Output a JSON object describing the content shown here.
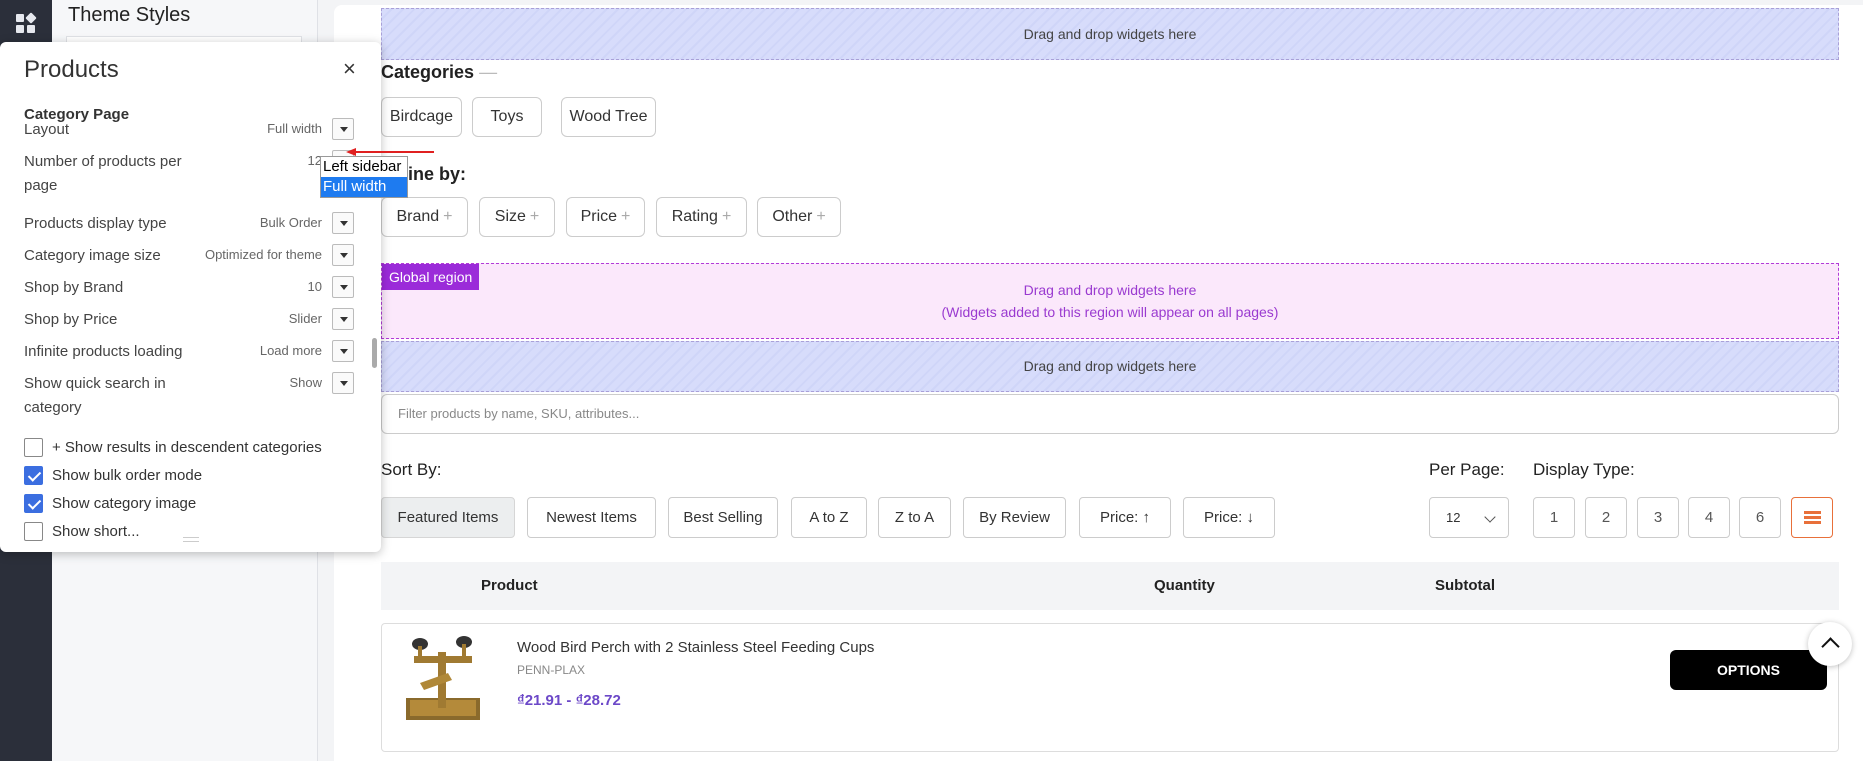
{
  "editor": {
    "title": "Theme Styles"
  },
  "popover": {
    "title": "Products",
    "close_label": "×",
    "section": "Category Page",
    "settings": [
      {
        "label": "Layout",
        "value": "Full width"
      },
      {
        "label": "Number of products per page",
        "value": "12"
      },
      {
        "label": "Products display type",
        "value": "Bulk Order"
      },
      {
        "label": "Category image size",
        "value": "Optimized for theme"
      },
      {
        "label": "Shop by Brand",
        "value": "10"
      },
      {
        "label": "Shop by Price",
        "value": "Slider"
      },
      {
        "label": "Infinite products loading",
        "value": "Load more"
      },
      {
        "label": "Show quick search in category",
        "value": "Show"
      }
    ],
    "checks": [
      {
        "label": "+ Show results in descendent categories",
        "checked": false
      },
      {
        "label": "Show bulk order mode",
        "checked": true
      },
      {
        "label": "Show category image",
        "checked": true
      },
      {
        "label": "Show short...",
        "checked": false
      }
    ],
    "dropdown_options": [
      "Left sidebar",
      "Full width"
    ],
    "dropdown_selected": "Full width"
  },
  "page": {
    "dropzone_text": "Drag and drop widgets here",
    "categories_label": "Categories",
    "categories_dash": "—",
    "categories": [
      "Birdcage",
      "Toys",
      "Wood Tree"
    ],
    "refine_label": "ine by:",
    "refine_filters": [
      "Brand",
      "Size",
      "Price",
      "Rating",
      "Other"
    ],
    "global_region": {
      "tag": "Global region",
      "line1": "Drag and drop widgets here",
      "line2": "(Widgets added to this region will appear on all pages)"
    },
    "search_placeholder": "Filter products by name, SKU, attributes...",
    "sort_by_label": "Sort By:",
    "sort_options": [
      "Featured Items",
      "Newest Items",
      "Best Selling",
      "A to Z",
      "Z to A",
      "By Review",
      "Price: ↑",
      "Price: ↓"
    ],
    "per_page_label": "Per Page:",
    "per_page_value": "12",
    "display_type_label": "Display Type:",
    "display_types": [
      "1",
      "2",
      "3",
      "4",
      "6"
    ],
    "table_headers": {
      "product": "Product",
      "quantity": "Quantity",
      "subtotal": "Subtotal"
    },
    "product": {
      "name": "Wood Bird Perch with 2 Stainless Steel Feeding Cups",
      "brand": "PENN-PLAX",
      "price": "₫21.91 - ₫28.72",
      "button": "OPTIONS"
    }
  },
  "colors": {
    "accent": "#e8703a",
    "price": "#6c48c8",
    "global_region": "#9b2bd9",
    "checkbox": "#3b6ee0"
  }
}
